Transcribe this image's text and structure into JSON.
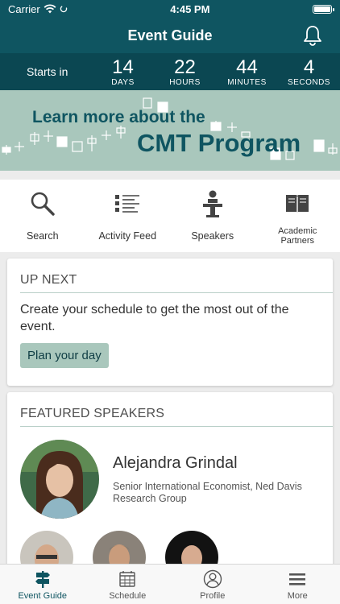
{
  "status_bar": {
    "carrier": "Carrier",
    "time": "4:45 PM"
  },
  "header": {
    "title": "Event Guide"
  },
  "countdown": {
    "label": "Starts in",
    "units": [
      {
        "value": "14",
        "unit": "DAYS"
      },
      {
        "value": "22",
        "unit": "HOURS"
      },
      {
        "value": "44",
        "unit": "MINUTES"
      },
      {
        "value": "4",
        "unit": "SECONDS"
      }
    ]
  },
  "banner": {
    "line1": "Learn more about the",
    "line2": "CMT Program"
  },
  "quick_nav": [
    {
      "label": "Search",
      "icon": "search-icon"
    },
    {
      "label": "Activity Feed",
      "icon": "activity-feed-icon"
    },
    {
      "label": "Speakers",
      "icon": "speaker-podium-icon"
    },
    {
      "label": "Academic Partners",
      "icon": "book-icon"
    }
  ],
  "up_next": {
    "title": "UP NEXT",
    "description": "Create your schedule to get the most out of the event.",
    "button": "Plan your day"
  },
  "featured_speakers": {
    "title": "FEATURED SPEAKERS",
    "main": {
      "name": "Alejandra Grindal",
      "title": "Senior International Economist, Ned Davis Research Group"
    }
  },
  "tab_bar": [
    {
      "label": "Event Guide",
      "icon": "signpost-icon",
      "active": true
    },
    {
      "label": "Schedule",
      "icon": "calendar-icon",
      "active": false
    },
    {
      "label": "Profile",
      "icon": "user-icon",
      "active": false
    },
    {
      "label": "More",
      "icon": "menu-icon",
      "active": false
    }
  ],
  "colors": {
    "primary": "#0f5561",
    "banner": "#a9c7bc",
    "button": "#a9c7bc"
  }
}
